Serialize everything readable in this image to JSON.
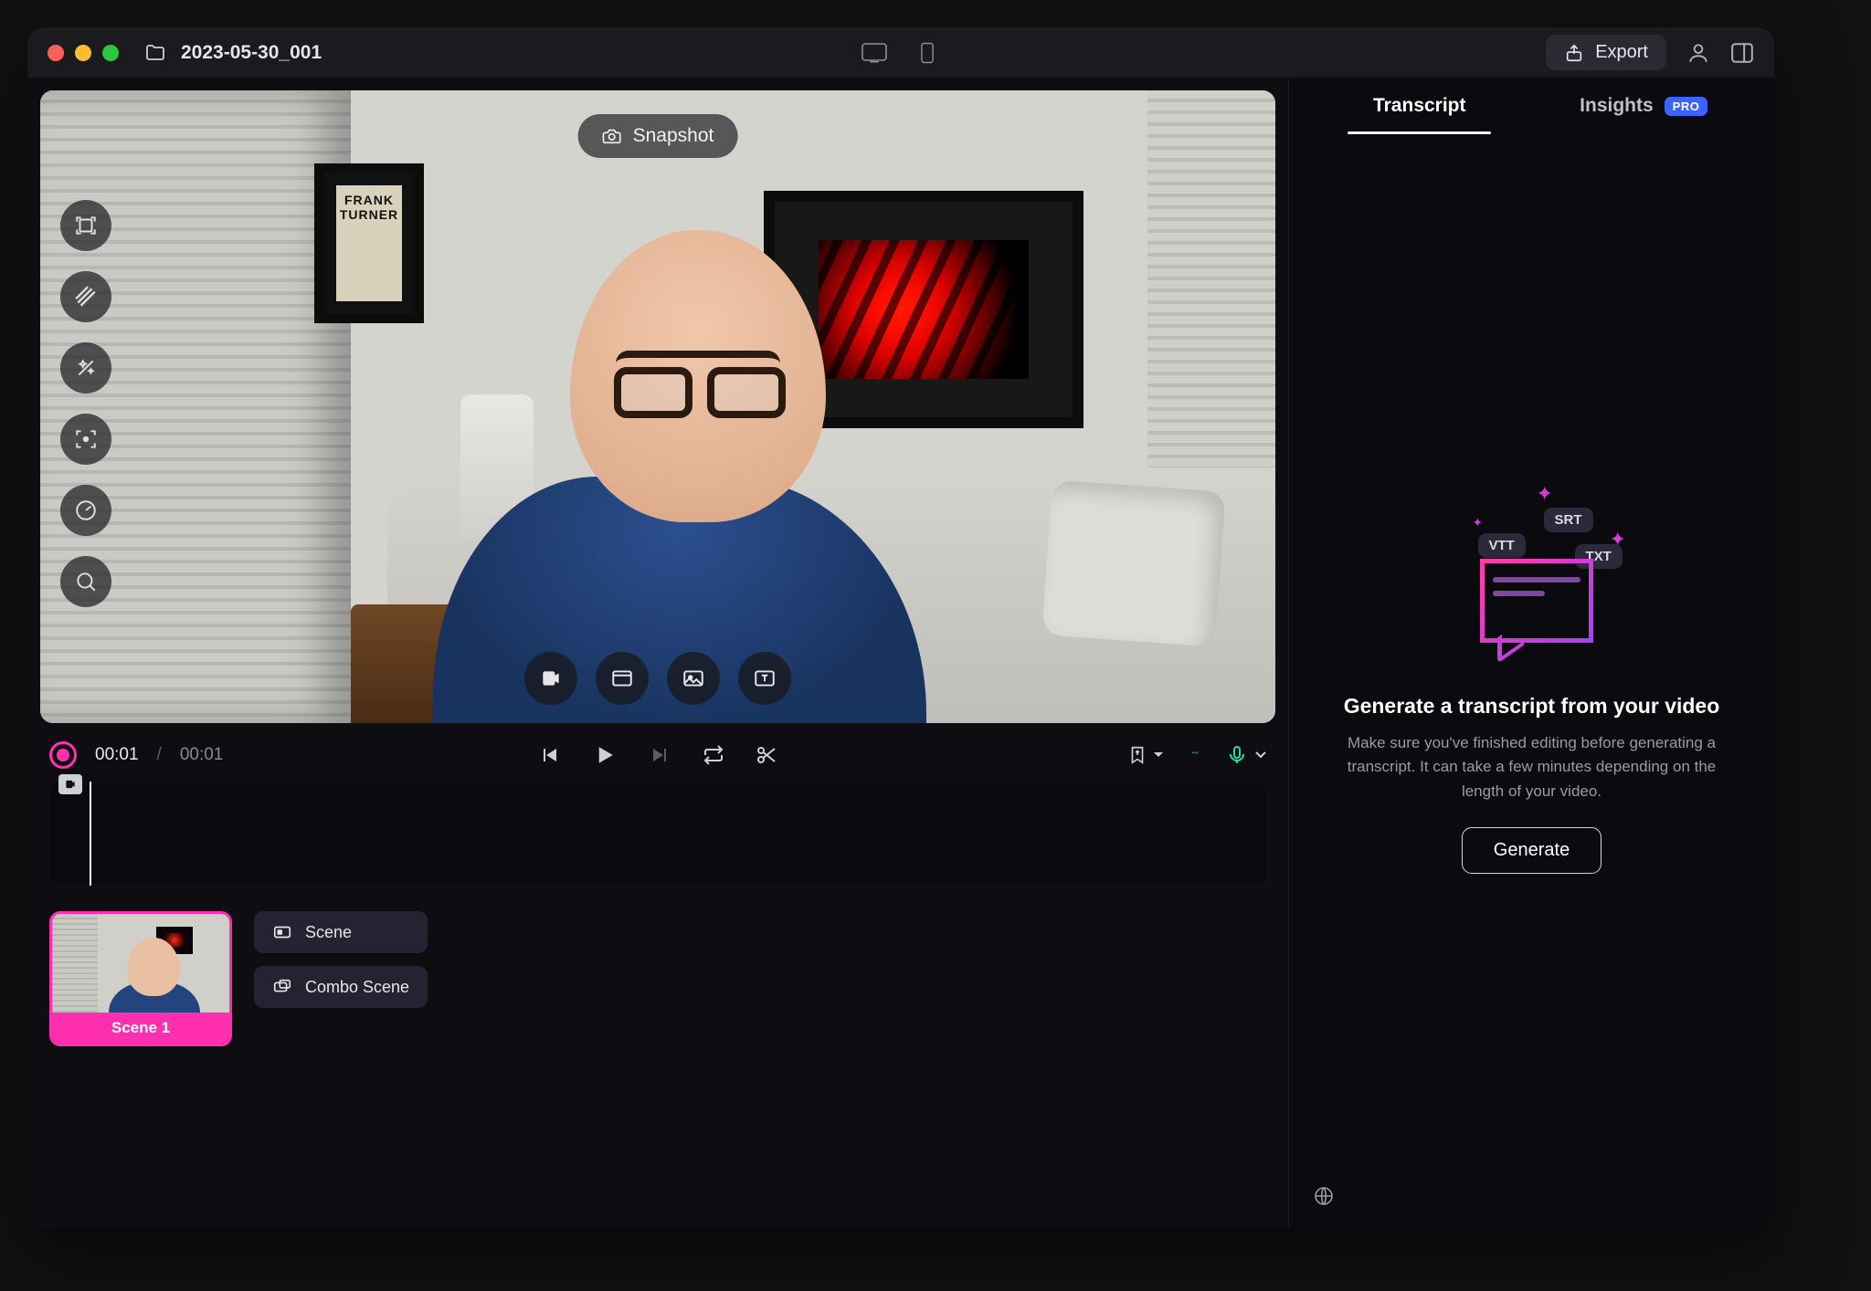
{
  "titlebar": {
    "project_name": "2023-05-30_001",
    "export_label": "Export"
  },
  "stage": {
    "snapshot_label": "Snapshot",
    "poster_text": "FRANK TURNER"
  },
  "playbar": {
    "current_time": "00:01",
    "total_time": "00:01"
  },
  "scenes": {
    "card_label": "Scene 1",
    "scene_btn": "Scene",
    "combo_btn": "Combo Scene"
  },
  "right_panel": {
    "tab_transcript": "Transcript",
    "tab_insights": "Insights",
    "pro_badge": "PRO",
    "chips": {
      "vtt": "VTT",
      "srt": "SRT",
      "txt": "TXT"
    },
    "title": "Generate a transcript from your video",
    "description": "Make sure you've finished editing before generating a transcript. It can take a few minutes depending on the length of your video.",
    "generate_label": "Generate"
  }
}
